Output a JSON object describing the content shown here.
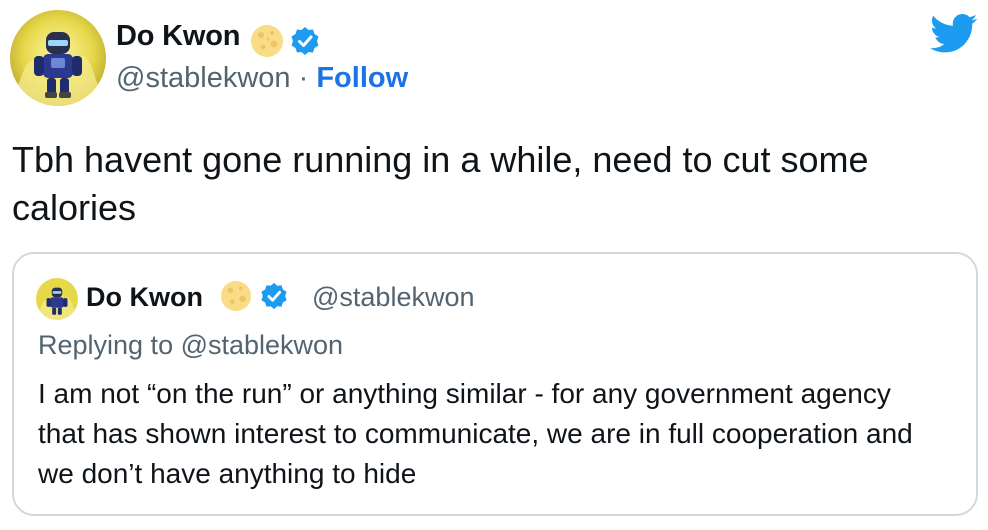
{
  "author": {
    "display_name": "Do Kwon",
    "handle": "@stablekwon",
    "separator": "·",
    "follow_label": "Follow",
    "verified": true,
    "name_emoji": "moon-emoji",
    "avatar": "avatar-robot-icon"
  },
  "tweet": {
    "text": "Tbh havent gone running in a while, need to cut some calories"
  },
  "quoted_tweet": {
    "display_name": "Do Kwon",
    "handle": "@stablekwon",
    "replying_to": "Replying to @stablekwon",
    "text": "I am not “on the run” or anything similar - for any government agency that has shown interest to communicate, we are in full cooperation and we don’t have anything to hide"
  },
  "colors": {
    "accent": "#1b74e4",
    "twitter_blue": "#1d9bf0",
    "muted_text": "#536471",
    "border": "#cfd9de"
  },
  "icons": {
    "brand": "twitter-bird-icon",
    "verified": "verified-badge-icon",
    "emoji": "full-moon-emoji-icon"
  }
}
